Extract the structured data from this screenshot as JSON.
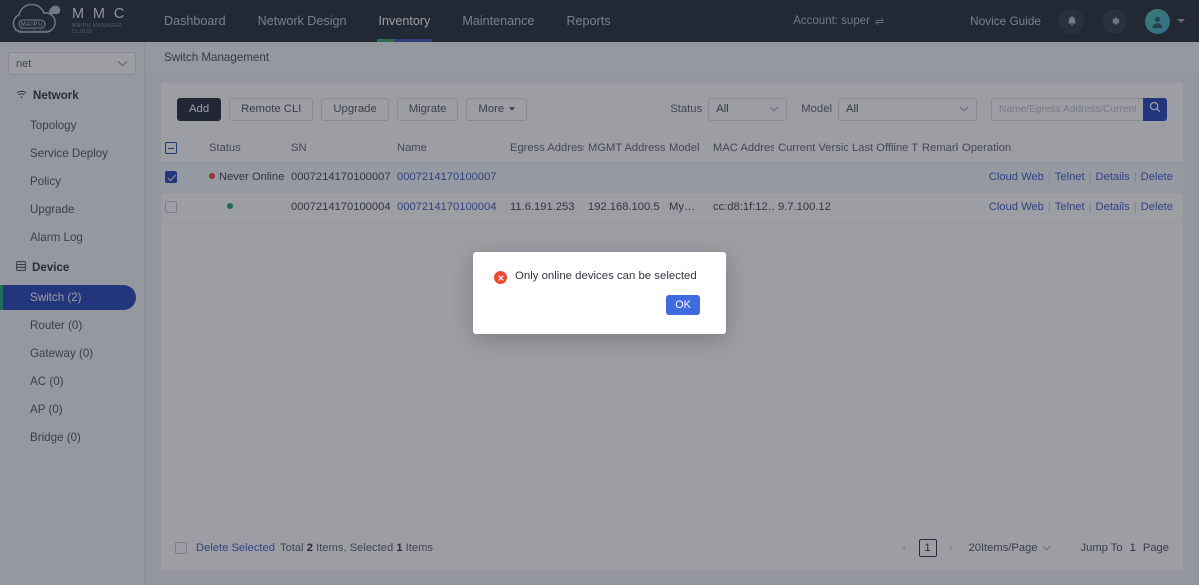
{
  "header": {
    "logo_name": "M M C",
    "logo_sub": "MAIPU MANAGED CLOUD",
    "logo_badge": "MAIPU",
    "logo_tagline": "MAKE IT INTELLIGENT",
    "nav": [
      {
        "label": "Dashboard",
        "active": false
      },
      {
        "label": "Network Design",
        "active": false
      },
      {
        "label": "Inventory",
        "active": true
      },
      {
        "label": "Maintenance",
        "active": false
      },
      {
        "label": "Reports",
        "active": false
      }
    ],
    "account": "Account: super",
    "account_switch_icon": "⇌",
    "novice_guide": "Novice Guide",
    "bell_icon": "bell-icon",
    "gear_icon": "gear-icon",
    "avatar_icon": "avatar-icon"
  },
  "sidebar": {
    "network_select": "net",
    "groups": [
      {
        "label": "Network",
        "icon": "wifi-icon",
        "items": [
          {
            "label": "Topology",
            "active": false
          },
          {
            "label": "Service Deploy",
            "active": false
          },
          {
            "label": "Policy",
            "active": false
          },
          {
            "label": "Upgrade",
            "active": false
          },
          {
            "label": "Alarm Log",
            "active": false
          }
        ]
      },
      {
        "label": "Device",
        "icon": "device-icon",
        "items": [
          {
            "label": "Switch (2)",
            "active": true
          },
          {
            "label": "Router (0)",
            "active": false
          },
          {
            "label": "Gateway (0)",
            "active": false
          },
          {
            "label": "AC (0)",
            "active": false
          },
          {
            "label": "AP (0)",
            "active": false
          },
          {
            "label": "Bridge (0)",
            "active": false
          }
        ]
      }
    ]
  },
  "breadcrumb": "Switch Management",
  "toolbar": {
    "add_label": "Add",
    "remote_cli_label": "Remote CLI",
    "upgrade_label": "Upgrade",
    "migrate_label": "Migrate",
    "more_label": "More",
    "status_label": "Status",
    "status_value": "All",
    "model_label": "Model",
    "model_value": "All",
    "search_placeholder": "Name/Egress Address/Current Version",
    "search_value": "",
    "search_icon": "search-icon"
  },
  "table": {
    "columns": [
      "Status",
      "SN",
      "Name",
      "Egress Address",
      "MGMT Address",
      "Model",
      "MAC Address",
      "Current Version",
      "Last Offline Time",
      "Remarks",
      "Operation"
    ],
    "header_checkbox_state": "indeterminate",
    "rows": [
      {
        "checked": true,
        "status_text": "Never Online",
        "status_color": "red",
        "sn": "0007214170100007",
        "name": "0007214170100007",
        "egress_address": "",
        "mgmt_address": "",
        "model": "",
        "mac_address": "",
        "current_version": "",
        "last_offline_time": "",
        "remarks": "",
        "operations": [
          "Cloud Web",
          "Telnet",
          "Details",
          "Delete"
        ]
      },
      {
        "checked": false,
        "status_text": "",
        "status_color": "green",
        "sn": "0007214170100004",
        "name": "0007214170100004",
        "egress_address": "11.6.191.253",
        "mgmt_address": "192.168.100.5",
        "model": "My…",
        "mac_address": "cc:d8:1f:12…",
        "current_version": "9.7.100.12",
        "last_offline_time": "",
        "remarks": "",
        "operations": [
          "Cloud Web",
          "Telnet",
          "Details",
          "Delete"
        ]
      }
    ]
  },
  "footer": {
    "select_all_checked": false,
    "delete_selected": "Delete Selected",
    "total_prefix": "Total",
    "total_count": "2",
    "items_mid": "Items, Selected",
    "selected_count": "1",
    "items_suffix": "Items",
    "prev_arrow": "‹",
    "page_number": "1",
    "next_arrow": "›",
    "page_size": "20Items/Page",
    "jump_to": "Jump To",
    "jump_value": "1",
    "page_word": "Page"
  },
  "modal": {
    "icon": "error-circle-icon",
    "message": "Only online devices can be selected",
    "ok_label": "OK"
  },
  "colors": {
    "accent_blue": "#2440b8",
    "header_dark": "#232838",
    "status_red": "#e8453c",
    "status_green": "#18a06a",
    "link_blue": "#3f56c4",
    "modal_error": "#ec4a32",
    "ok_button": "#3f6ae0"
  }
}
